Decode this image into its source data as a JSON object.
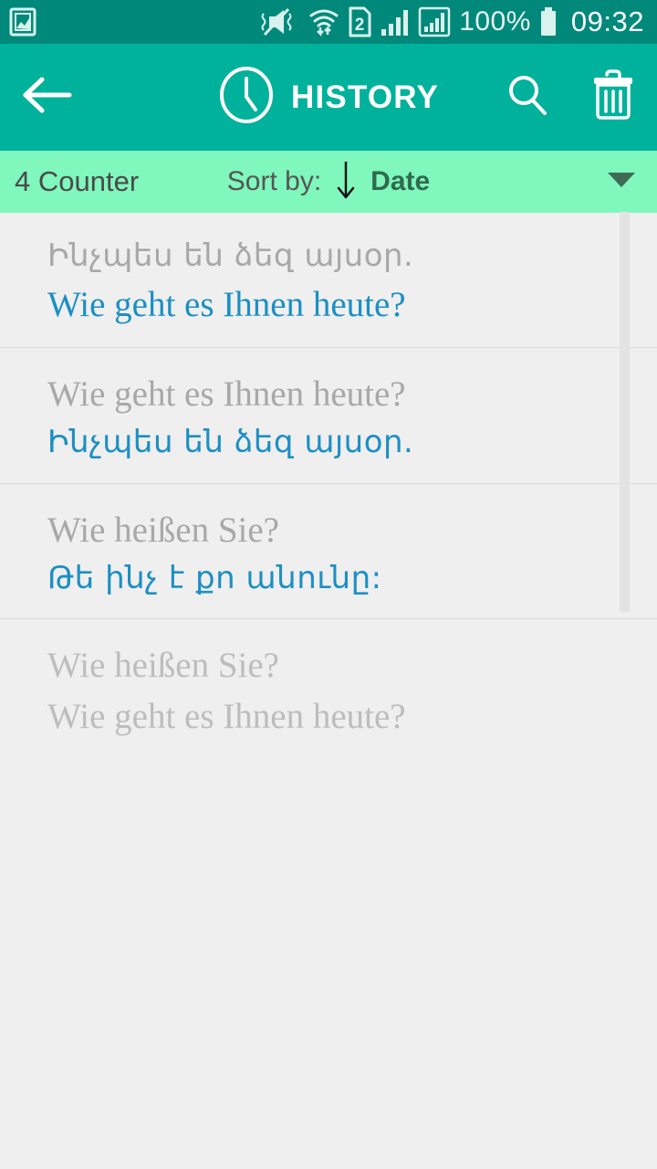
{
  "colors": {
    "statusbar_bg": "#00897b",
    "appbar_bg": "#00b19c",
    "sortbar_bg": "#80f7bd",
    "list_bg": "#efefef",
    "source_text": "#a8a8a8",
    "target_text": "#1c8fc4",
    "faded_text": "#bdbdbd"
  },
  "statusbar": {
    "gallery_icon": "gallery-icon",
    "mute_icon": "vibrate-mute-icon",
    "wifi_icon": "wifi-transfer-icon",
    "sim_icon": "sim-2-icon",
    "sim_label": "2",
    "signal1_icon": "signal-bars-icon",
    "signal2_icon": "signal-bars-boxed-icon",
    "battery_percent": "100%",
    "battery_icon": "battery-full-icon",
    "clock": "09:32"
  },
  "appbar": {
    "back_icon": "back-arrow-icon",
    "clock_icon": "clock-icon",
    "title": "HISTORY",
    "search_icon": "search-icon",
    "delete_icon": "trash-icon"
  },
  "sortbar": {
    "counter": "4 Counter",
    "sort_label": "Sort by:",
    "sort_direction_icon": "arrow-down-icon",
    "sort_value": "Date",
    "dropdown_icon": "chevron-down-icon"
  },
  "history": {
    "items": [
      {
        "source": "Ինչպես են ձեզ այսօր.",
        "source_script": "arm",
        "target": "Wie geht es Ihnen heute?",
        "target_script": "lat",
        "faded": false
      },
      {
        "source": "Wie geht es Ihnen heute?",
        "source_script": "lat",
        "target": "Ինչպես են ձեզ այսօր.",
        "target_script": "arm",
        "faded": false
      },
      {
        "source": "Wie heißen Sie?",
        "source_script": "lat",
        "target": "Թե ինչ է քո անունը:",
        "target_script": "arm",
        "faded": false
      },
      {
        "source": "Wie heißen Sie?",
        "source_script": "lat",
        "target": "Wie geht es Ihnen heute?",
        "target_script": "lat",
        "faded": true
      }
    ]
  }
}
